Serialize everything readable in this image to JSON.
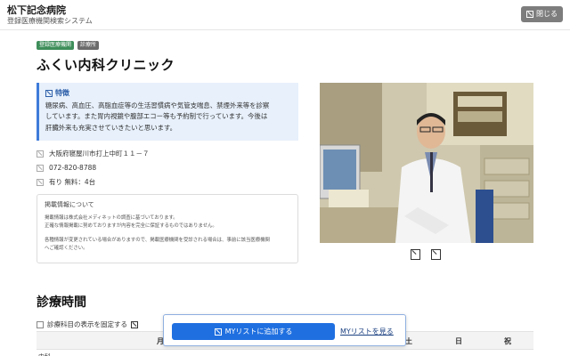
{
  "header": {
    "brand": "松下記念病院",
    "brand_sub": "登録医療機関検索システム",
    "close_label": "閉じる"
  },
  "badges": [
    "登録医療機関",
    "診療所"
  ],
  "clinic": {
    "name": "ふくい内科クリニック"
  },
  "feature": {
    "title": "特徴",
    "lines": [
      "糖尿病、高血圧、高脂血症等の生活習慣病や気管支喘息、禁煙外来等を診察",
      "しています。また胃内視鏡や腹部エコー等も予約制で行っています。今後は",
      "肝臓外来も充実させていきたいと思います。"
    ]
  },
  "info": {
    "address": "大阪府寝屋川市打上中町１１－７",
    "phone": "072-820-8788",
    "parking": "有り 無料：4台"
  },
  "notice": {
    "title": "掲載情報について",
    "lines": [
      "掲載情報は株式会社メディネットの調査に基づいております。",
      "正確な情報掲載に努めておりますが内容を完全に保証するものではありません。",
      "",
      "各種情報が変更されている場合がありますので、掲載医療機関を受診される場合は、事前に該当医療機関",
      "へご確認ください。"
    ]
  },
  "section": {
    "title": "診療時間",
    "fix_label": "診療科目の表示を固定する"
  },
  "table": {
    "headers": [
      "月",
      "土",
      "日",
      "祝"
    ],
    "row_label": "内科"
  },
  "floating": {
    "add_label": "MYリストに追加する",
    "see_label": "MYリストを見る"
  },
  "colors": {
    "accent": "#1f6fe0",
    "badge_green": "#3e8e5a",
    "feature_bg": "#e7f0fb"
  }
}
